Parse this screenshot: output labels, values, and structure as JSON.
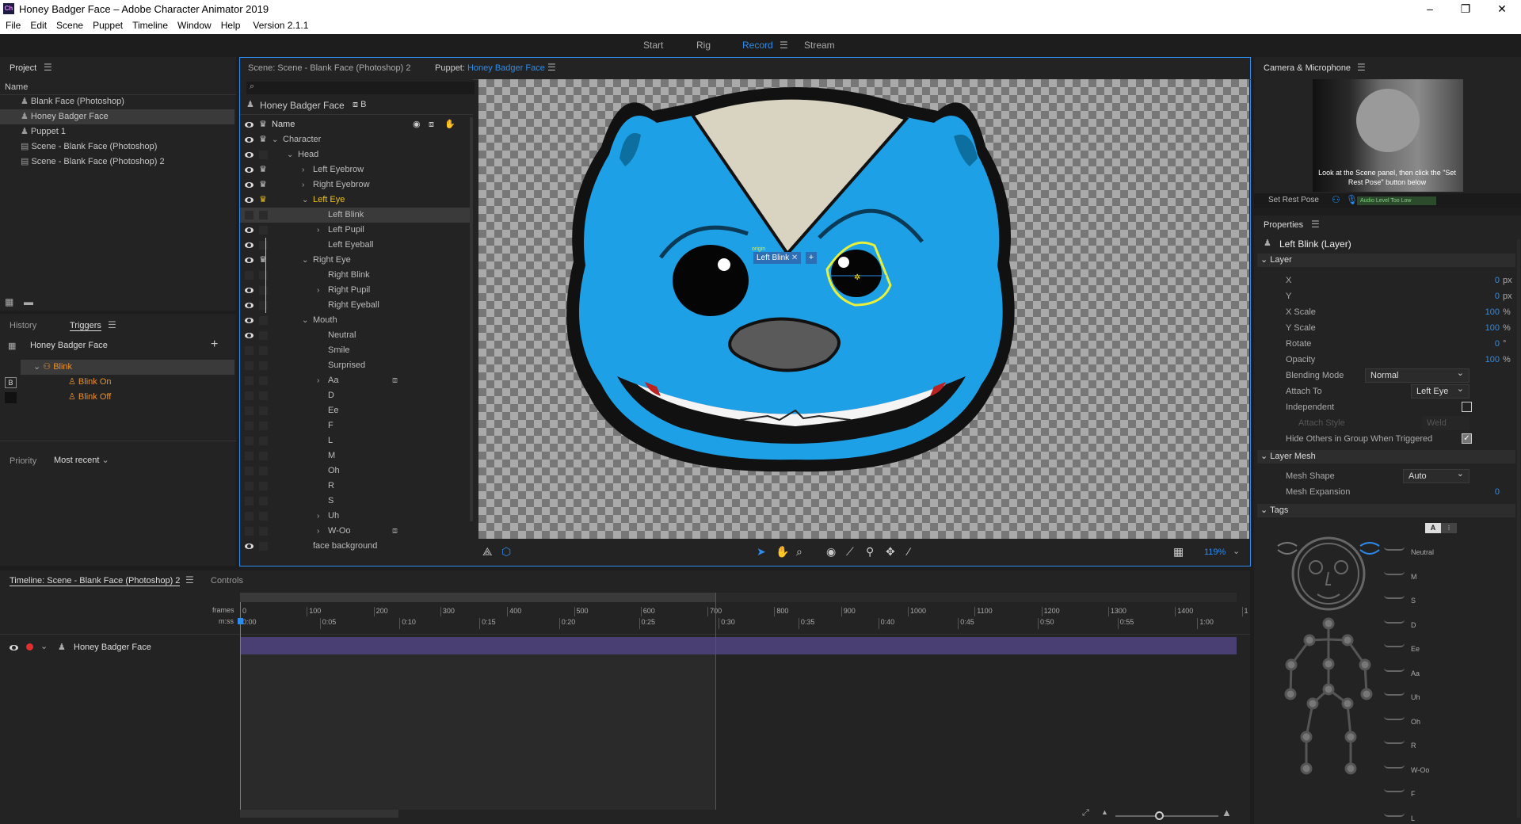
{
  "window": {
    "app_icon": "Ch",
    "title": "Honey Badger Face – Adobe Character Animator 2019",
    "minimize": "–",
    "maximize": "❐",
    "close": "✕"
  },
  "menu": {
    "items": [
      "File",
      "Edit",
      "Scene",
      "Puppet",
      "Timeline",
      "Window",
      "Help"
    ],
    "version": "Version 2.1.1"
  },
  "workspace": {
    "start": "Start",
    "rig": "Rig",
    "record": "Record",
    "stream": "Stream"
  },
  "project": {
    "title": "Project",
    "col_name": "Name",
    "items": [
      "Blank Face (Photoshop)",
      "Honey Badger Face",
      "Puppet 1",
      "Scene - Blank Face (Photoshop)",
      "Scene - Blank Face (Photoshop) 2"
    ]
  },
  "triggers": {
    "tab_history": "History",
    "tab_triggers": "Triggers",
    "puppet": "Honey Badger Face",
    "group": "Blink",
    "items": [
      {
        "key": "B",
        "label": "Blink On"
      },
      {
        "key": "",
        "label": "Blink Off"
      }
    ],
    "priority_label": "Priority",
    "priority_value": "Most recent"
  },
  "scene_tab": "Scene: Scene - Blank Face (Photoshop) 2",
  "puppet_tab_prefix": "Puppet:",
  "puppet_tab_name": "Honey Badger Face",
  "puppet_panel": {
    "header": "Honey Badger Face",
    "header_badge": "B",
    "col_name": "Name",
    "layers": [
      "Character",
      "Head",
      "Left Eyebrow",
      "Right Eyebrow",
      "Left Eye",
      "Left Blink",
      "Left Pupil",
      "Left Eyeball",
      "Right Eye",
      "Right Blink",
      "Right Pupil",
      "Right Eyeball",
      "Mouth",
      "Neutral",
      "Smile",
      "Surprised",
      "Aa",
      "D",
      "Ee",
      "F",
      "L",
      "M",
      "Oh",
      "R",
      "S",
      "Uh",
      "W-Oo",
      "face background"
    ]
  },
  "canvas": {
    "selection_label": "Left Blink",
    "origin_label": "origin",
    "zoom": "119%"
  },
  "camera": {
    "title": "Camera & Microphone",
    "hint": "Look at the Scene panel, then click the \"Set Rest Pose\" button below",
    "set_rest_pose": "Set Rest Pose",
    "audio_status": "Audio Level Too Low"
  },
  "properties": {
    "title": "Properties",
    "target": "Left Blink (Layer)",
    "layer_section": "Layer",
    "x_label": "X",
    "x_value": "0",
    "x_unit": "px",
    "y_label": "Y",
    "y_value": "0",
    "y_unit": "px",
    "xscale_label": "X Scale",
    "xscale_value": "100",
    "xscale_unit": "%",
    "yscale_label": "Y Scale",
    "yscale_value": "100",
    "yscale_unit": "%",
    "rotate_label": "Rotate",
    "rotate_value": "0",
    "rotate_unit": "°",
    "opacity_label": "Opacity",
    "opacity_value": "100",
    "opacity_unit": "%",
    "blending_label": "Blending Mode",
    "blending_value": "Normal",
    "attach_label": "Attach To",
    "attach_value": "Left Eye",
    "independent_label": "Independent",
    "attach_style_label": "Attach Style",
    "attach_style_value": "Weld",
    "hide_others_label": "Hide Others in Group When Triggered",
    "mesh_section": "Layer Mesh",
    "mesh_shape_label": "Mesh Shape",
    "mesh_shape_value": "Auto",
    "mesh_exp_label": "Mesh Expansion",
    "mesh_exp_value": "0",
    "tags_section": "Tags",
    "tags_btn_a": "A",
    "tags": [
      "Neutral",
      "M",
      "S",
      "D",
      "Ee",
      "Aa",
      "Uh",
      "Oh",
      "R",
      "W-Oo",
      "F",
      "L"
    ]
  },
  "timeline": {
    "tab": "Timeline: Scene - Blank Face (Photoshop) 2",
    "tab_controls": "Controls",
    "frames_label": "frames",
    "mss_label": "m:ss",
    "frames": [
      "0",
      "100",
      "200",
      "300",
      "400",
      "500",
      "600",
      "700",
      "800",
      "900",
      "1000",
      "1100",
      "1200",
      "1300",
      "1400",
      "1"
    ],
    "times": [
      "0:00",
      "0:05",
      "0:10",
      "0:15",
      "0:20",
      "0:25",
      "0:30",
      "0:35",
      "0:40",
      "0:45",
      "0:50",
      "0:55",
      "1:00"
    ],
    "track": "Honey Badger Face"
  }
}
